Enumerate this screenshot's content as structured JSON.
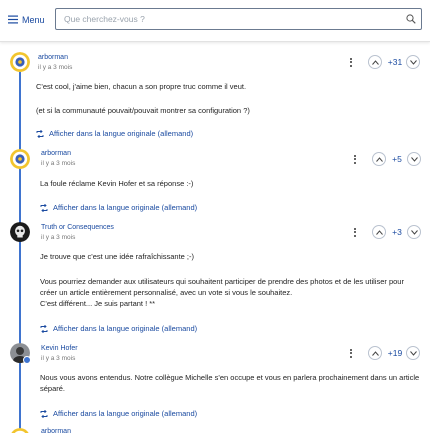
{
  "header": {
    "menu_label": "Menu",
    "search_placeholder": "Que cherchez-vous ?"
  },
  "colors": {
    "accent": "#1a4aa0",
    "thread_line": "#3f74cf"
  },
  "comments": [
    {
      "author": "arborman",
      "time": "il y a 3 mois",
      "score": "+31",
      "paragraphs": [
        "C'est cool, j'aime bien, chacun a son propre truc comme il veut.",
        "(et si la communauté pouvait/pouvait montrer sa configuration ?)"
      ],
      "translate_label": "Afficher dans la langue originale (allemand)",
      "avatar_icon": "badge-avatar"
    },
    {
      "author": "arborman",
      "time": "il y a 3 mois",
      "score": "+5",
      "paragraphs": [
        "La foule réclame Kevin Hofer et sa réponse :-)"
      ],
      "translate_label": "Afficher dans la langue originale (allemand)",
      "avatar_icon": "badge-avatar"
    },
    {
      "author": "Truth or Consequences",
      "time": "il y a 3 mois",
      "score": "+3",
      "paragraphs": [
        "Je trouve que c'est une idée rafraîchissante ;-)",
        "Vous pourriez demander aux utilisateurs qui souhaitent participer de prendre des photos et de les utiliser pour créer un article entièrement personnalisé, avec un vote si vous le souhaitez.\nC'est différent... Je suis partant ! **"
      ],
      "translate_label": "Afficher dans la langue originale (allemand)",
      "avatar_icon": "skull-avatar"
    },
    {
      "author": "Kevin Hofer",
      "time": "il y a 3 mois",
      "score": "+19",
      "paragraphs": [
        "Nous vous avons entendus. Notre collègue Michelle s'en occupe et vous en parlera prochainement dans un article séparé."
      ],
      "translate_label": "Afficher dans la langue originale (allemand)",
      "avatar_icon": "photo-avatar"
    },
    {
      "author": "arborman",
      "avatar_icon": "badge-avatar"
    }
  ]
}
